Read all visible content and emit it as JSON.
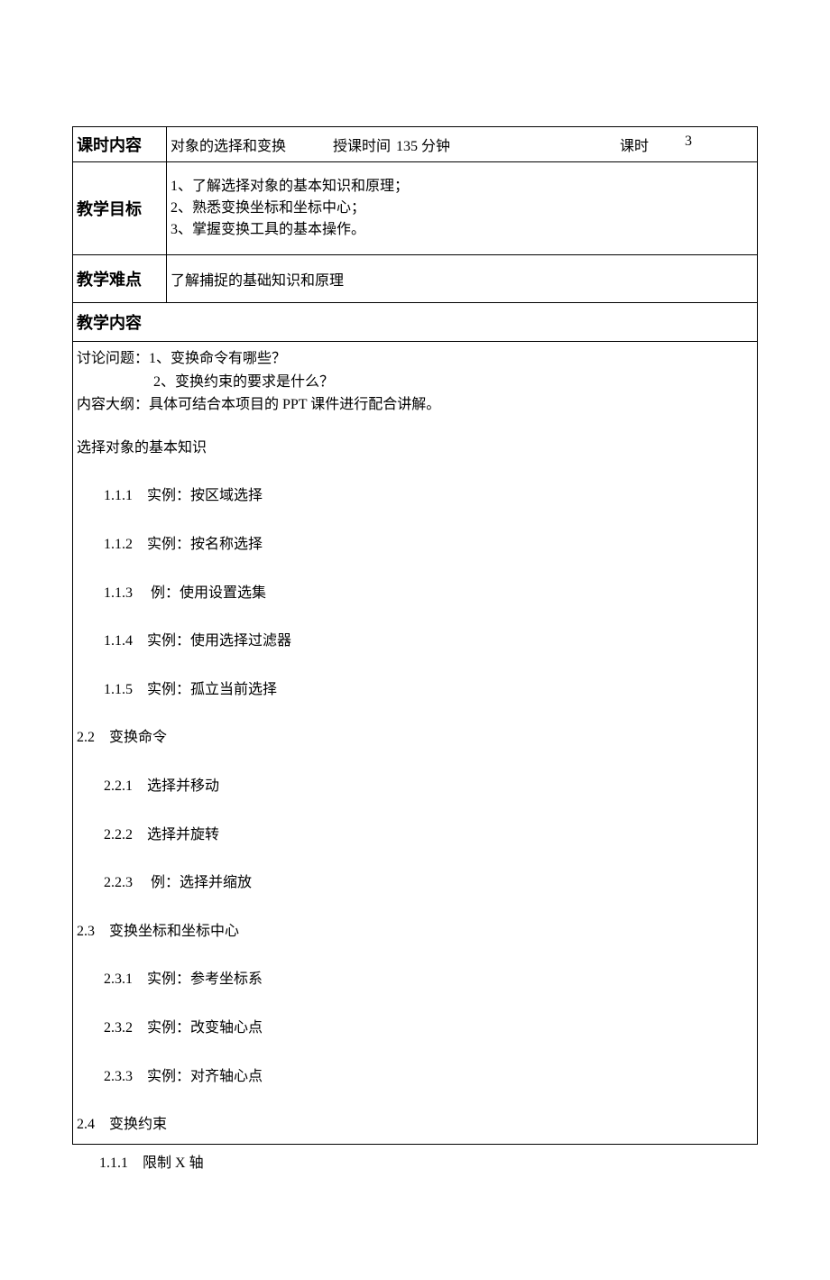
{
  "row1": {
    "label": "课时内容",
    "title": "对象的选择和变换",
    "time_label": "授课时间",
    "time_value": "135 分钟",
    "keshi_label": "课时",
    "keshi_value": "3"
  },
  "objectives": {
    "label": "教学目标",
    "items": [
      "1、了解选择对象的基本知识和原理；",
      "2、熟悉变换坐标和坐标中心；",
      "3、掌握变换工具的基本操作。"
    ]
  },
  "difficulty": {
    "label": "教学难点",
    "text": "了解捕捉的基础知识和原理"
  },
  "content_heading": "教学内容",
  "discussion": {
    "line1": "讨论问题：1、变换命令有哪些？",
    "line2": "2、变换约束的要求是什么？"
  },
  "outline_note": "内容大纲：具体可结合本项目的 PPT 课件进行配合讲解。",
  "section1_heading": "选择对象的基本知识",
  "section1_items": [
    {
      "num": "1.1.1",
      "text": "实例：按区域选择"
    },
    {
      "num": "1.1.2",
      "text": "实例：按名称选择"
    },
    {
      "num": "1.1.3",
      "text": "    例：使用设置选集"
    },
    {
      "num": "1.1.4",
      "text": "实例：使用选择过滤器"
    },
    {
      "num": "1.1.5",
      "text": "实例：孤立当前选择"
    }
  ],
  "section2_heading": "2.2　变换命令",
  "section2_items": [
    {
      "num": "2.2.1",
      "text": "选择并移动"
    },
    {
      "num": "2.2.2",
      "text": "选择并旋转"
    },
    {
      "num": "2.2.3",
      "text": "    例：选择并缩放"
    }
  ],
  "section3_heading": "2.3　变换坐标和坐标中心",
  "section3_items": [
    {
      "num": "2.3.1",
      "text": "实例：参考坐标系"
    },
    {
      "num": "2.3.2",
      "text": "实例：改变轴心点"
    },
    {
      "num": "2.3.3",
      "text": "实例：对齐轴心点"
    }
  ],
  "section4_heading": "2.4　变换约束",
  "after_table_item": {
    "num": "1.1.1",
    "text": "限制 X 轴"
  }
}
